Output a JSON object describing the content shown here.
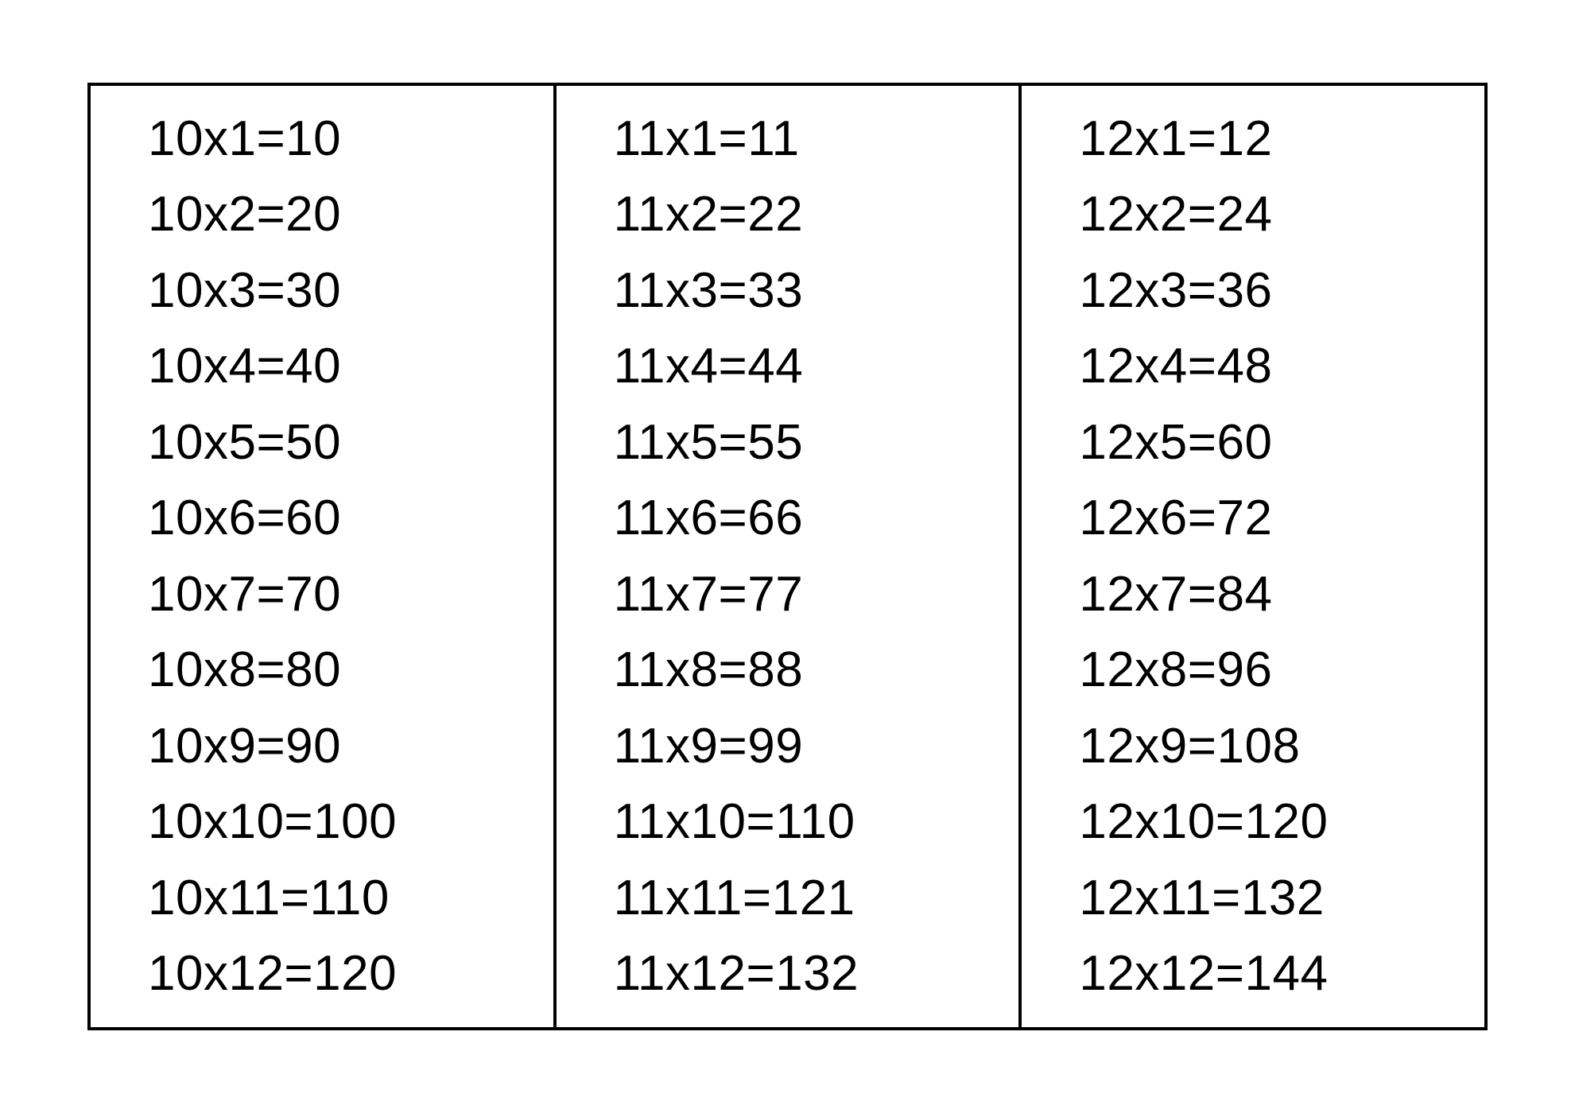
{
  "columns": [
    {
      "name": "times-table-10",
      "rows": [
        "10x1=10",
        "10x2=20",
        "10x3=30",
        "10x4=40",
        "10x5=50",
        "10x6=60",
        "10x7=70",
        "10x8=80",
        "10x9=90",
        "10x10=100",
        "10x11=110",
        "10x12=120"
      ]
    },
    {
      "name": "times-table-11",
      "rows": [
        "11x1=11",
        "11x2=22",
        "11x3=33",
        "11x4=44",
        "11x5=55",
        "11x6=66",
        "11x7=77",
        "11x8=88",
        "11x9=99",
        "11x10=110",
        "11x11=121",
        "11x12=132"
      ]
    },
    {
      "name": "times-table-12",
      "rows": [
        "12x1=12",
        "12x2=24",
        "12x3=36",
        "12x4=48",
        "12x5=60",
        "12x6=72",
        "12x7=84",
        "12x8=96",
        "12x9=108",
        "12x10=120",
        "12x11=132",
        "12x12=144"
      ]
    }
  ]
}
